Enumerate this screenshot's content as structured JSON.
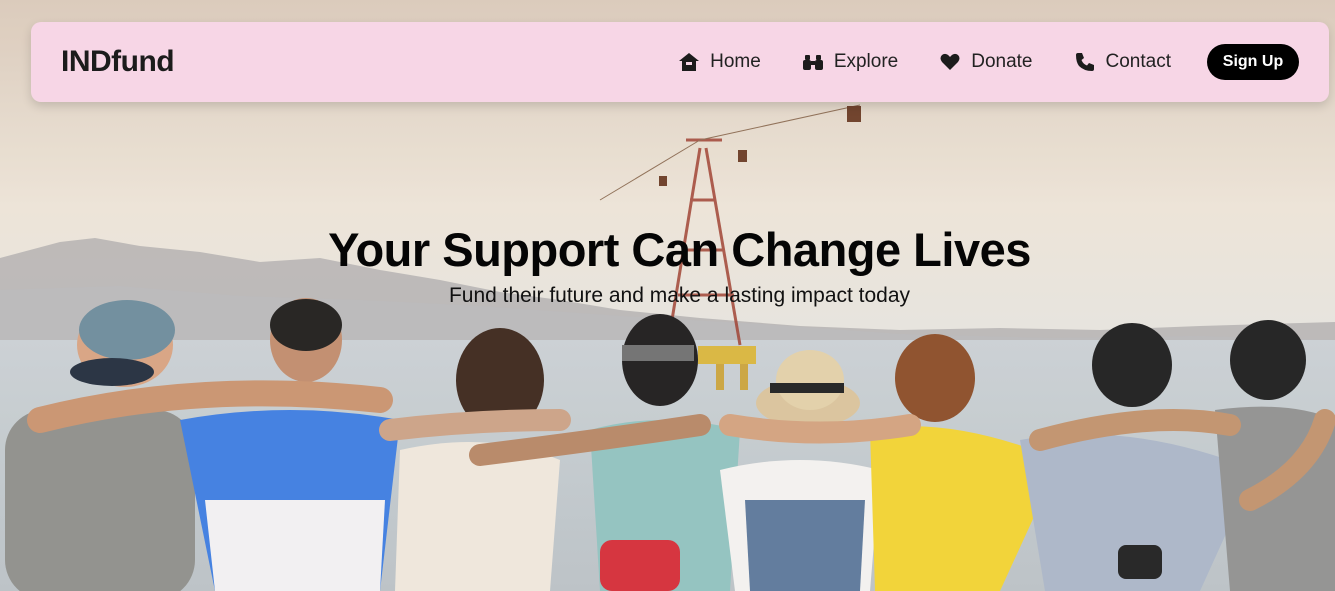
{
  "brand": {
    "name": "INDfund"
  },
  "nav": {
    "items": [
      {
        "label": "Home",
        "icon": "home-icon"
      },
      {
        "label": "Explore",
        "icon": "binoculars-icon"
      },
      {
        "label": "Donate",
        "icon": "heart-icon"
      },
      {
        "label": "Contact",
        "icon": "phone-icon"
      }
    ],
    "signup_label": "Sign Up"
  },
  "hero": {
    "title": "Your Support Can Change Lives",
    "subtitle": "Fund their future and make a lasting impact today",
    "image": "group-of-friends-arm-in-arm-by-the-sea"
  },
  "colors": {
    "navbar_bg": "#f7d6e6",
    "signup_bg": "#000000",
    "text_dark": "#1c1c1c"
  }
}
